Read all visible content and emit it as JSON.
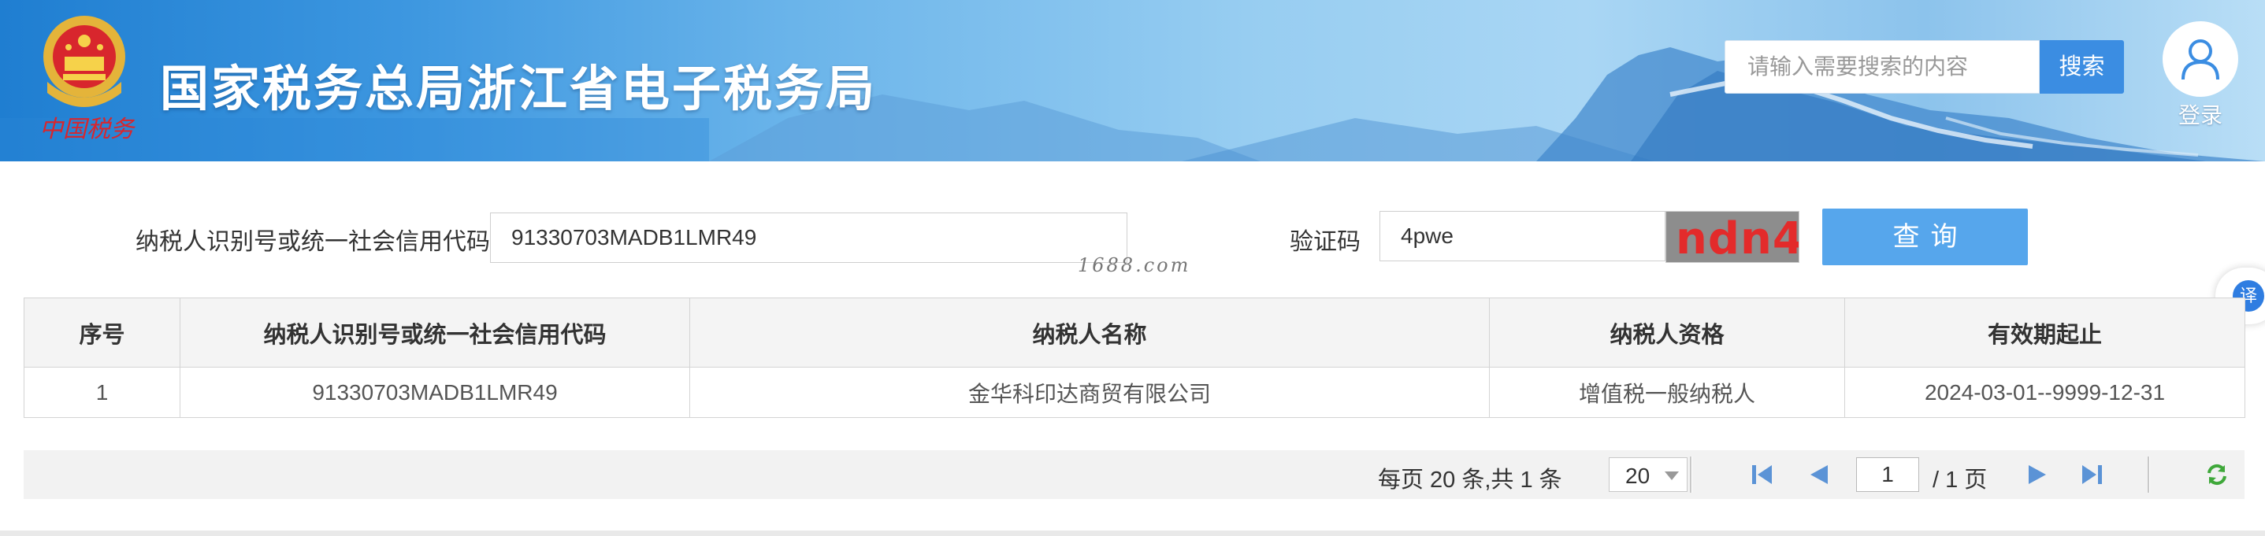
{
  "header": {
    "site_title": "国家税务总局浙江省电子税务局",
    "emblem_caption": "中国税务",
    "search_placeholder": "请输入需要搜索的内容",
    "search_button": "搜索",
    "login_label": "登录"
  },
  "form": {
    "tin_label": "纳税人识别号或统一社会信用代码",
    "tin_value": "91330703MADB1LMR49",
    "captcha_label": "验证码",
    "captcha_value": "4pwe",
    "captcha_image_text": "ndn4",
    "query_button": "查询"
  },
  "watermark": "1688.com",
  "translate_button": "译",
  "table": {
    "headers": [
      "序号",
      "纳税人识别号或统一社会信用代码",
      "纳税人名称",
      "纳税人资格",
      "有效期起止"
    ],
    "rows": [
      [
        "1",
        "91330703MADB1LMR49",
        "金华科印达商贸有限公司",
        "增值税一般纳税人",
        "2024-03-01--9999-12-31"
      ]
    ]
  },
  "pagination": {
    "summary": "每页 20 条,共 1 条",
    "page_size": "20",
    "current_page": "1",
    "total_pages": "/ 1 页"
  },
  "colors": {
    "header_blue": "#1f7ed1",
    "search_button": "#3b8de2",
    "query_button": "#56a6ec",
    "captcha_text": "#e32b2b",
    "pager_icons": "#5b93d6",
    "refresh_icon": "#3fa83a"
  }
}
